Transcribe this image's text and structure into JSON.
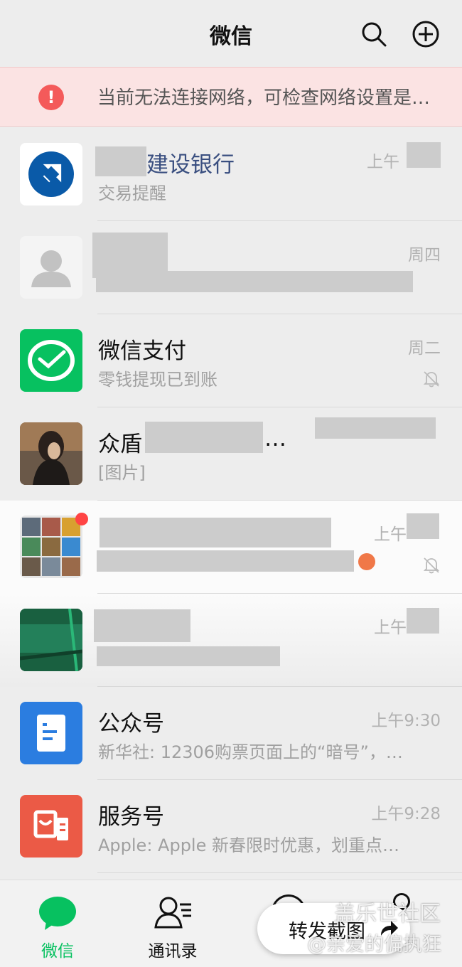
{
  "header": {
    "title": "微信",
    "icons": [
      "search-icon",
      "add-circle-icon"
    ]
  },
  "banner": {
    "icon": "!",
    "text": "当前无法连接网络，可检查网络设置是…"
  },
  "chats": [
    {
      "name": "建设银行",
      "subtitle": "交易提醒",
      "time": "上午",
      "avatar": "ccb-logo",
      "muted": false
    },
    {
      "name": "",
      "subtitle": "",
      "time": "周四",
      "avatar": "default-user",
      "muted": false
    },
    {
      "name": "微信支付",
      "subtitle": "零钱提现已到账",
      "time": "周二",
      "avatar": "wechat-pay-logo",
      "muted": true
    },
    {
      "name": "众盾",
      "name_suffix": "…",
      "subtitle": "[图片]",
      "time": "",
      "avatar": "photo",
      "muted": false
    },
    {
      "name": "",
      "subtitle": "",
      "time": "上午",
      "avatar": "group-grid",
      "muted": true,
      "unread_dot": true
    },
    {
      "name": "",
      "subtitle": "",
      "time": "上午",
      "avatar": "photo-green",
      "muted": false
    },
    {
      "name": "公众号",
      "subtitle": "新华社: 12306购票页面上的“暗号”，…",
      "time": "上午9:30",
      "avatar": "official-accounts",
      "muted": false
    },
    {
      "name": "服务号",
      "subtitle": "Apple: Apple 新春限时优惠，划重点…",
      "time": "上午9:28",
      "avatar": "service-accounts",
      "muted": false
    }
  ],
  "tabs": [
    {
      "label": "微信",
      "active": true
    },
    {
      "label": "通讯录",
      "active": false
    }
  ],
  "share": {
    "label": "转发截图"
  },
  "watermark": {
    "line1": "盖乐世社区",
    "line2": "@亲爱的偏执狂"
  },
  "colors": {
    "accent": "#07c160",
    "alert": "#f45a5a",
    "bank_blue": "#0a5aa8",
    "official_blue": "#2b7de0",
    "service_red": "#eb5a46"
  }
}
